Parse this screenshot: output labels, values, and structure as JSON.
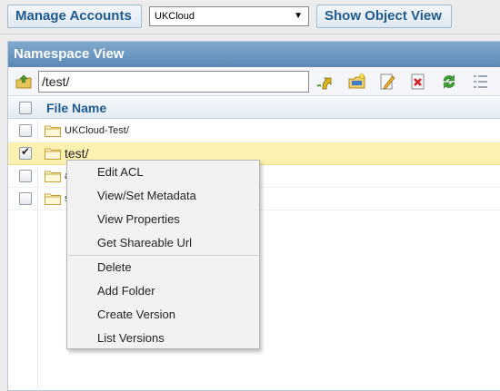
{
  "toolbar": {
    "manage_label": "Manage Accounts",
    "account_selected": "UKCloud",
    "show_label": "Show Object View"
  },
  "panel": {
    "title": "Namespace View",
    "path": "/test/"
  },
  "grid": {
    "column_name": "File Name",
    "rows": [
      {
        "label": "UKCloud-Test/",
        "checked": false,
        "selected": false
      },
      {
        "label": "test/",
        "checked": true,
        "selected": true
      },
      {
        "label": "a",
        "checked": false,
        "selected": false
      },
      {
        "label": "s",
        "checked": false,
        "selected": false
      }
    ]
  },
  "context_menu": {
    "items": [
      "Edit ACL",
      "View/Set Metadata",
      "View Properties",
      "Get Shareable Url",
      "Delete",
      "Add Folder",
      "Create Version",
      "List Versions"
    ]
  },
  "icons": [
    "up-folder-icon",
    "upload-icon",
    "new-folder-icon",
    "edit-icon",
    "delete-icon",
    "refresh-icon",
    "column-toggle-icon"
  ],
  "colors": {
    "header_blue": "#5b88b4",
    "button_text": "#1e5a8f",
    "selected_row": "#fdf1b2"
  }
}
